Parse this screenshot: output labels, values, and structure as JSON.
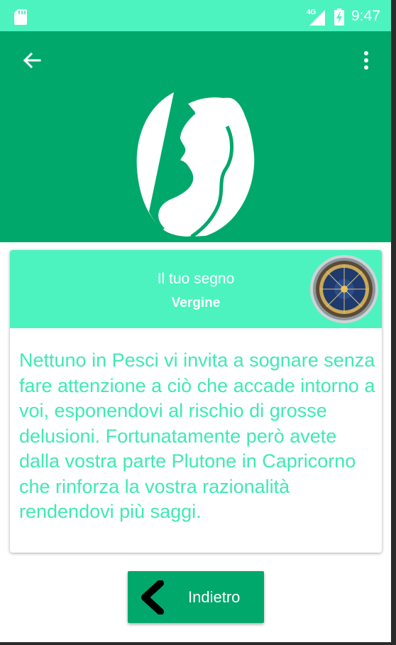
{
  "status_bar": {
    "network": "4G",
    "time": "9:47"
  },
  "app_bar": {
    "back_icon": "arrow-left-icon",
    "menu_icon": "more-vert-icon",
    "sign_image": "virgo-silhouette"
  },
  "card": {
    "label": "Il tuo segno",
    "sign": "Vergine",
    "icon": "zodiac-wheel-icon",
    "horoscope": "Nettuno in Pesci vi invita a sognare senza fare attenzione a ciò che accade intorno a voi, esponendovi al rischio di grosse delusioni. Fortunatamente però avete dalla vostra parte Plutone in Capricorno che rinforza la vostra razionalità rendendovi più saggi."
  },
  "footer": {
    "back_button_label": "Indietro",
    "back_button_icon": "chevron-left-icon"
  },
  "colors": {
    "status_bar": "#4cf3be",
    "app_bar": "#00a86b",
    "card_header": "#4cf3be",
    "body_text": "#3fe9b4",
    "button": "#00a86b"
  }
}
